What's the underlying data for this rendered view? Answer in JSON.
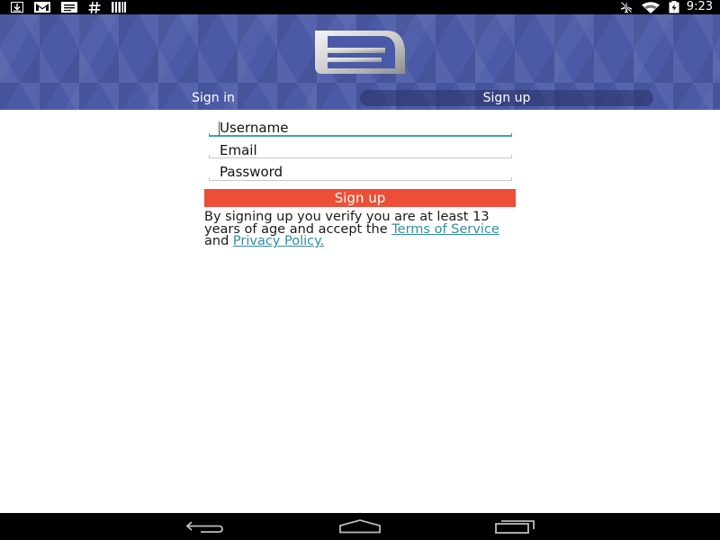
{
  "status_bar": {
    "left_icons": [
      "download-icon",
      "gmail-icon",
      "message-icon",
      "hashtag-icon",
      "barcode-icon"
    ],
    "right_icons": [
      "airplane-mode-icon",
      "wifi-icon",
      "battery-charging-icon"
    ],
    "time": "9:23"
  },
  "header": {
    "logo_icon": "app-logo-icon",
    "background_color": "#4a5aa7",
    "tabs": [
      {
        "label": "Sign in",
        "active": false
      },
      {
        "label": "Sign up",
        "active": true
      }
    ]
  },
  "form": {
    "username": {
      "placeholder": "Username",
      "value": ""
    },
    "email": {
      "placeholder": "Email",
      "value": ""
    },
    "password": {
      "placeholder": "Password",
      "value": ""
    },
    "submit_label": "Sign up",
    "submit_color": "#ec4f36",
    "terms": {
      "text_before": "By signing up you verify you are at least 13 years of age and accept the ",
      "tos_link": "Terms of Service",
      "text_middle": " and ",
      "privacy_link": "Privacy Policy.",
      "link_color": "#2f8fa0"
    }
  },
  "nav_bar": {
    "buttons": [
      "back-icon",
      "home-icon",
      "recents-icon"
    ]
  }
}
